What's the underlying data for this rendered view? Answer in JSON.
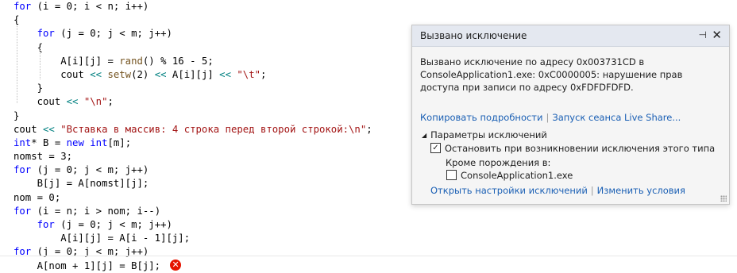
{
  "code_lines": [
    [
      {
        "t": "for",
        "c": "kw"
      },
      {
        "t": " (i = 0; i < n; i++)",
        "c": ""
      }
    ],
    [
      {
        "t": "{",
        "c": ""
      }
    ],
    [
      {
        "t": "    ",
        "c": ""
      },
      {
        "t": "for",
        "c": "kw"
      },
      {
        "t": " (j = 0; j < m; j++)",
        "c": ""
      }
    ],
    [
      {
        "t": "    {",
        "c": ""
      }
    ],
    [
      {
        "t": "        A[i][j] = ",
        "c": ""
      },
      {
        "t": "rand",
        "c": "fn"
      },
      {
        "t": "() % 16 - 5;",
        "c": ""
      }
    ],
    [
      {
        "t": "        cout ",
        "c": ""
      },
      {
        "t": "<<",
        "c": "op"
      },
      {
        "t": " ",
        "c": ""
      },
      {
        "t": "setw",
        "c": "fn"
      },
      {
        "t": "(2) ",
        "c": ""
      },
      {
        "t": "<<",
        "c": "op"
      },
      {
        "t": " A[i][j] ",
        "c": ""
      },
      {
        "t": "<<",
        "c": "op"
      },
      {
        "t": " ",
        "c": ""
      },
      {
        "t": "\"\\t\"",
        "c": "str"
      },
      {
        "t": ";",
        "c": ""
      }
    ],
    [
      {
        "t": "    }",
        "c": ""
      }
    ],
    [
      {
        "t": "    cout ",
        "c": ""
      },
      {
        "t": "<<",
        "c": "op"
      },
      {
        "t": " ",
        "c": ""
      },
      {
        "t": "\"\\n\"",
        "c": "str"
      },
      {
        "t": ";",
        "c": ""
      }
    ],
    [
      {
        "t": "}",
        "c": ""
      }
    ],
    [
      {
        "t": "cout ",
        "c": ""
      },
      {
        "t": "<<",
        "c": "op"
      },
      {
        "t": " ",
        "c": ""
      },
      {
        "t": "\"Вставка в массив: 4 строка перед второй строкой:\\n\"",
        "c": "str"
      },
      {
        "t": ";",
        "c": ""
      }
    ],
    [
      {
        "t": "int",
        "c": "kw"
      },
      {
        "t": "* B = ",
        "c": ""
      },
      {
        "t": "new",
        "c": "kw"
      },
      {
        "t": " ",
        "c": ""
      },
      {
        "t": "int",
        "c": "kw"
      },
      {
        "t": "[m];",
        "c": ""
      }
    ],
    [
      {
        "t": "nomst = 3;",
        "c": ""
      }
    ],
    [
      {
        "t": "for",
        "c": "kw"
      },
      {
        "t": " (j = 0; j < m; j++)",
        "c": ""
      }
    ],
    [
      {
        "t": "    B[j] = A[nomst][j];",
        "c": ""
      }
    ],
    [
      {
        "t": "nom = 0;",
        "c": ""
      }
    ],
    [
      {
        "t": "for",
        "c": "kw"
      },
      {
        "t": " (i = n; i > nom; i--)",
        "c": ""
      }
    ],
    [
      {
        "t": "    ",
        "c": ""
      },
      {
        "t": "for",
        "c": "kw"
      },
      {
        "t": " (j = 0; j < m; j++)",
        "c": ""
      }
    ],
    [
      {
        "t": "        A[i][j] = A[i - 1][j];",
        "c": ""
      }
    ],
    [
      {
        "t": "for",
        "c": "kw"
      },
      {
        "t": " (j = 0; j < m; j++)",
        "c": ""
      }
    ],
    [
      {
        "t": "    A[nom + 1][j] = B[j];",
        "c": ""
      }
    ]
  ],
  "error_marker": {
    "icon": "error-icon",
    "glyph": "✕",
    "line_index": 19
  },
  "exception_popup": {
    "title": "Вызвано исключение",
    "pin_glyph": "⊣",
    "close_glyph": "✕",
    "message": "Вызвано исключение по адресу 0x003731CD в ConsoleApplication1.exe: 0xC0000005: нарушение прав доступа при записи по адресу 0xFDFDFDFD.",
    "link_copy_details": "Копировать подробности",
    "link_live_share": "Запуск сеанса Live Share...",
    "settings_section": "Параметры исключений",
    "break_option": "Остановить при возникновении исключения этого типа",
    "break_option_checked": true,
    "except_label": "Кроме порождения в:",
    "module_option": "ConsoleApplication1.exe",
    "module_option_checked": false,
    "link_open_settings": "Открыть настройки исключений",
    "link_edit_conditions": "Изменить условия"
  },
  "colors": {
    "keyword": "#0000ff",
    "string": "#a31515",
    "operator": "#008080",
    "function": "#74531f",
    "link": "#1a5fb4",
    "error": "#e51400"
  }
}
